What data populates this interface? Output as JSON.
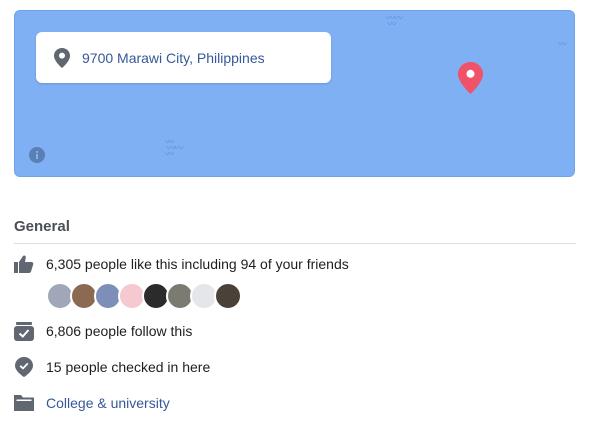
{
  "map": {
    "address": "9700 Marawi City, Philippines"
  },
  "section": {
    "title": "General"
  },
  "likes": {
    "text": "6,305 people like this including 94 of your friends"
  },
  "friends_avatars": [
    {
      "color": "#9fa7b8"
    },
    {
      "color": "#8c6a52"
    },
    {
      "color": "#7d8fb8"
    },
    {
      "color": "#f5c9cf"
    },
    {
      "color": "#2b2b2b"
    },
    {
      "color": "#7b7b72"
    },
    {
      "color": "#e4e6ea"
    },
    {
      "color": "#4a4238"
    }
  ],
  "follows": {
    "text": "6,806 people follow this"
  },
  "checkins": {
    "text": "15 people checked in here"
  },
  "category": {
    "text": "College & university"
  },
  "colors": {
    "map_water": "#7fb0f3",
    "marker": "#f0526a",
    "link": "#365899",
    "icon": "#606770"
  }
}
